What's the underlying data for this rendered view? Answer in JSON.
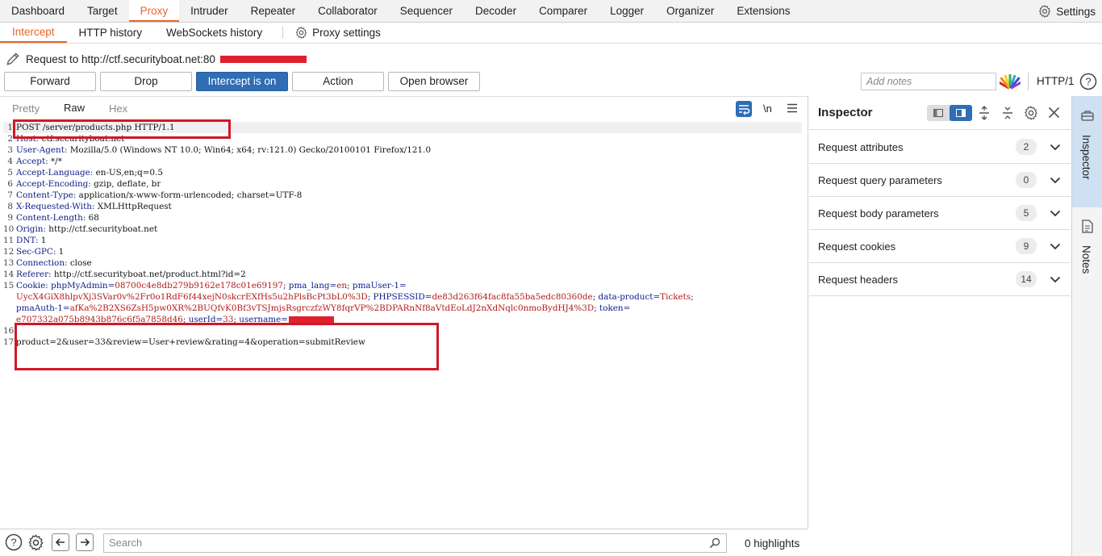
{
  "top_tabs": [
    "Dashboard",
    "Target",
    "Proxy",
    "Intruder",
    "Repeater",
    "Collaborator",
    "Sequencer",
    "Decoder",
    "Comparer",
    "Logger",
    "Organizer",
    "Extensions"
  ],
  "active_top_tab": "Proxy",
  "settings_label": "Settings",
  "sub_tabs": {
    "intercept": "Intercept",
    "http_history": "HTTP history",
    "websockets_history": "WebSockets history",
    "proxy_settings": "Proxy settings"
  },
  "request_line": "Request to http://ctf.securityboat.net:80",
  "buttons": {
    "forward": "Forward",
    "drop": "Drop",
    "intercept": "Intercept is on",
    "action": "Action",
    "open_browser": "Open browser"
  },
  "notes_placeholder": "Add notes",
  "http_version": "HTTP/1",
  "editor_tabs": {
    "pretty": "Pretty",
    "raw": "Raw",
    "hex": "Hex"
  },
  "newline_toggle": "\\n",
  "request": {
    "l1": "POST /server/products.php HTTP/1.1",
    "l2_name": "Host:",
    "l2_val": " ctf.securityboat.net",
    "l3_name": "User-Agent:",
    "l3_val": " Mozilla/5.0 (Windows NT 10.0; Win64; x64; rv:121.0) Gecko/20100101 Firefox/121.0",
    "l4_name": "Accept:",
    "l4_val": " */*",
    "l5_name": "Accept-Language:",
    "l5_val": " en-US,en;q=0.5",
    "l6_name": "Accept-Encoding:",
    "l6_val": " gzip, deflate, br",
    "l7_name": "Content-Type:",
    "l7_val": " application/x-www-form-urlencoded; charset=UTF-8",
    "l8_name": "X-Requested-With:",
    "l8_val": " XMLHttpRequest",
    "l9_name": "Content-Length:",
    "l9_val": " 68",
    "l10_name": "Origin:",
    "l10_val": " http://ctf.securityboat.net",
    "l11_name": "DNT:",
    "l11_val": " 1",
    "l12_name": "Sec-GPC:",
    "l12_val": " 1",
    "l13_name": "Connection:",
    "l13_val": " close",
    "l14_name": "Referer:",
    "l14_val": " http://ctf.securityboat.net/product.html?id=2",
    "l15_name": "Cookie:",
    "c1_k": " phpMyAdmin=",
    "c1_v": "08700c4e8db279b9162e178c01e69197",
    "c2_k": "; pma_lang=",
    "c2_v": "en",
    "c3_k": "; pmaUser-1=",
    "c3_v_a": "UycX4GiX8hlpvXj3SVar0v%2Fr0o1RdF6f44xejN0skcrEXfHs5u2hPlsBcPt3bL0%3D",
    "c4_k": "; PHPSESSID=",
    "c4_v": "de83d263f64fac8fa55ba5edc80360de",
    "c5_k": "; data-product=",
    "c5_v": "Tickets",
    "c6_k": "; ",
    "c6_name": "pmaAuth-1=",
    "c6_v": "afKa%2B2XS6ZsH5pw0XR%2BUQfvK0Bf3vTSJmjsRsgrczfzWY8fqrVP%2BDPARnNf8aVtdEoLdJ2nXdNqlc0nmoBydHJ4%3D",
    "c7_k": "; token=",
    "c7_v": "e707332a075b8943b876c6f5a7858d46",
    "c8_k": "; userId=",
    "c8_v": "33",
    "c9_k": "; username=",
    "l17": "product=2&user=33&review=User+review&rating=4&operation=submitReview"
  },
  "line_numbers": [
    "1",
    "2",
    "3",
    "4",
    "5",
    "6",
    "7",
    "8",
    "9",
    "10",
    "11",
    "12",
    "13",
    "14",
    "15",
    "16",
    "17"
  ],
  "search_placeholder": "Search",
  "highlights": "0 highlights",
  "inspector": {
    "title": "Inspector",
    "rows": [
      {
        "label": "Request attributes",
        "count": "2"
      },
      {
        "label": "Request query parameters",
        "count": "0"
      },
      {
        "label": "Request body parameters",
        "count": "5"
      },
      {
        "label": "Request cookies",
        "count": "9"
      },
      {
        "label": "Request headers",
        "count": "14"
      }
    ]
  },
  "rail": {
    "inspector": "Inspector",
    "notes": "Notes"
  },
  "colors": {
    "accent": "#e8652b",
    "primary_button": "#2f6db5",
    "redaction": "#e0202c",
    "rail_active": "#cfe0f2"
  }
}
